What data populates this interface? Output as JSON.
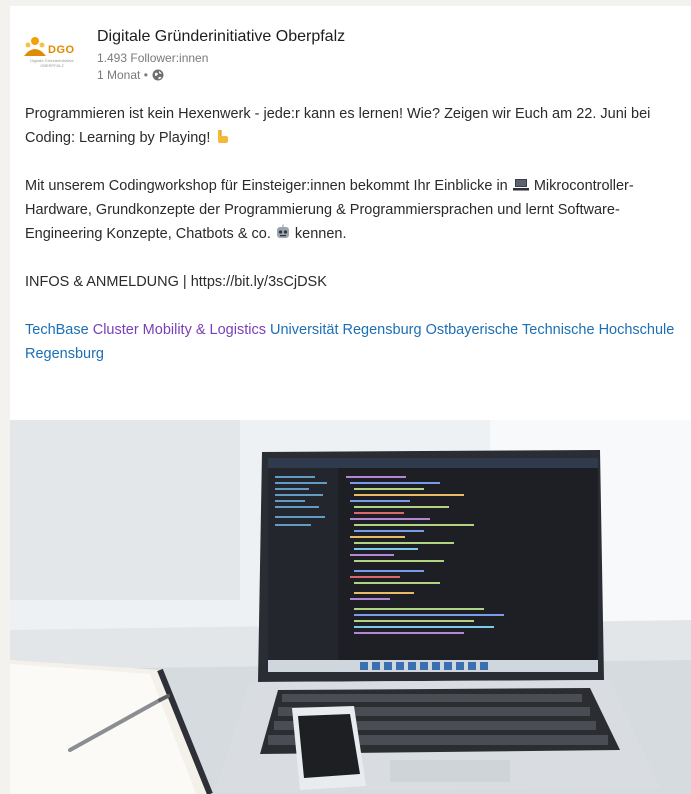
{
  "post": {
    "author": "Digitale Gründerinitiative Oberpfalz",
    "logo_text": "DGO",
    "logo_subtext": "Digitale Gründerinitiative OBERPFALZ",
    "followers": "1.493 Follower:innen",
    "time": "1 Monat •",
    "paragraph1": "Programmieren ist kein Hexenwerk - jede:r kann es lernen! Wie? Zeigen wir Euch am 22. Juni bei Coding: Learning by Playing!",
    "paragraph2_part1": "Mit unserem Codingworkshop für Einsteiger:innen bekommt Ihr Einblicke in",
    "paragraph2_part2": "Mikrocontroller-Hardware, Grundkonzepte der Programmierung & Programmiersprachen und lernt Software-Engineering Konzepte, Chatbots & co.",
    "paragraph2_part3": "kennen.",
    "paragraph3": "INFOS & ANMELDUNG | https://bit.ly/3sCjDSK",
    "mentions": {
      "m1": "TechBase",
      "m2": "Cluster Mobility & Logistics",
      "m3": "Universität Regensburg",
      "m4": "Ostbayerische Technische Hochschule Regensburg"
    },
    "emoji": {
      "pointing_hand": "hand-pointing-icon",
      "laptop": "laptop-icon",
      "robot": "robot-icon"
    }
  },
  "colors": {
    "mention_blue": "#1b6fb5",
    "mention_purple": "#7a3fb8",
    "logo_orange": "#e08a00"
  }
}
